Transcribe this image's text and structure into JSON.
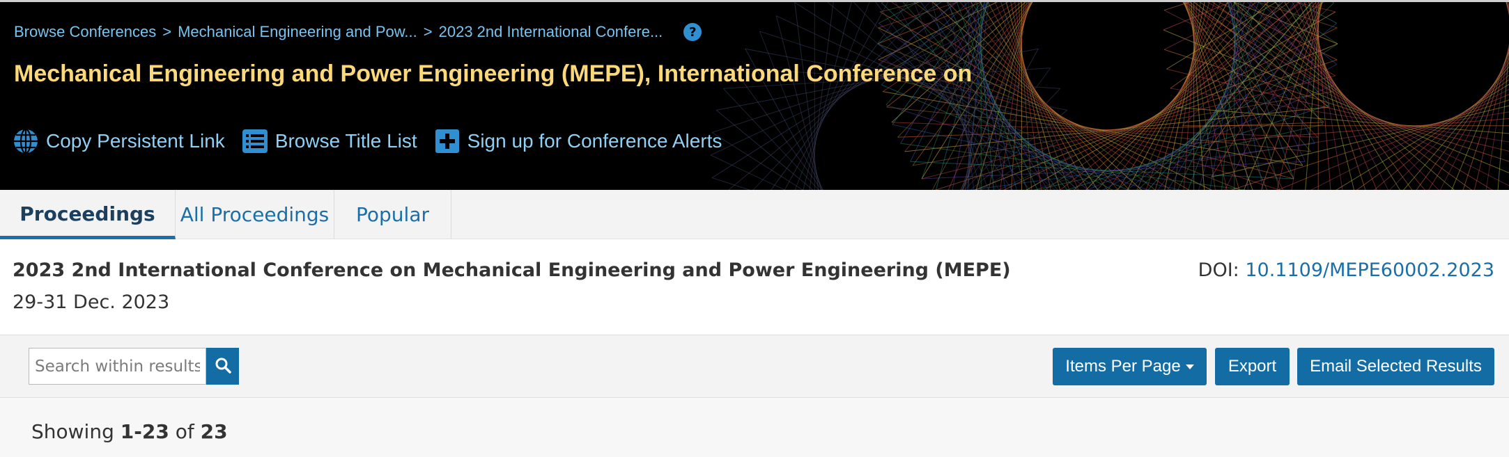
{
  "breadcrumb": {
    "items": [
      "Browse Conferences",
      "Mechanical Engineering and Pow...",
      "2023 2nd International Confere..."
    ],
    "separator": ">"
  },
  "conference_title": "Mechanical Engineering and Power Engineering (MEPE), International Conference on",
  "actions": [
    {
      "label": "Copy Persistent Link",
      "icon": "globe-icon"
    },
    {
      "label": "Browse Title List",
      "icon": "list-icon"
    },
    {
      "label": "Sign up for Conference Alerts",
      "icon": "plus-icon"
    }
  ],
  "tabs": [
    {
      "label": "Proceedings",
      "active": true
    },
    {
      "label": "All Proceedings",
      "active": false
    },
    {
      "label": "Popular",
      "active": false
    }
  ],
  "proceeding": {
    "title": "2023 2nd International Conference on Mechanical Engineering and Power Engineering (MEPE)",
    "dates": "29-31 Dec. 2023",
    "doi_label": "DOI:",
    "doi_value": "10.1109/MEPE60002.2023"
  },
  "toolbar": {
    "search_placeholder": "Search within results",
    "search_value": "",
    "items_per_page_label": "Items Per Page",
    "export_label": "Export",
    "email_label": "Email Selected Results"
  },
  "results": {
    "prefix": "Showing",
    "range": "1-23",
    "of_label": "of",
    "total": "23"
  },
  "colors": {
    "banner_background": "#000000",
    "title_gold": "#fbd97a",
    "link_light_blue": "#79c3ef",
    "primary_button": "#136ca3",
    "link_blue": "#1a6fa8"
  }
}
